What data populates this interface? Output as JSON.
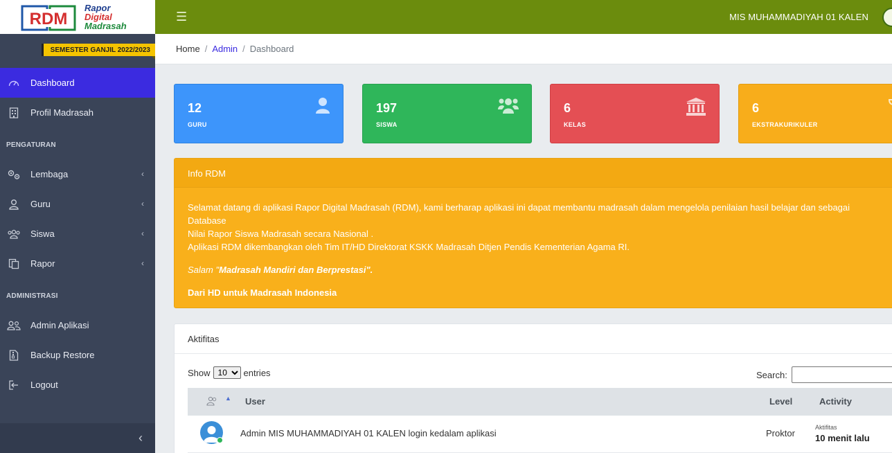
{
  "brand": {
    "line1": "Rapor",
    "line2": "Digital",
    "line3": "Madrasah",
    "logo_text": "RDM"
  },
  "semester": "SEMESTER GANJIL 2022/2023",
  "sidebar": {
    "items": [
      {
        "label": "Dashboard",
        "icon": "speedometer-icon",
        "active": true
      },
      {
        "label": "Profil Madrasah",
        "icon": "building-icon"
      }
    ],
    "section_pengaturan": "PENGATURAN",
    "pengaturan_items": [
      {
        "label": "Lembaga",
        "icon": "gears-icon"
      },
      {
        "label": "Guru",
        "icon": "user-icon"
      },
      {
        "label": "Siswa",
        "icon": "users-icon"
      },
      {
        "label": "Rapor",
        "icon": "copy-icon"
      }
    ],
    "section_admin": "ADMINISTRASI",
    "admin_items": [
      {
        "label": "Admin Aplikasi",
        "icon": "user-group-icon"
      },
      {
        "label": "Backup Restore",
        "icon": "file-archive-icon"
      },
      {
        "label": "Logout",
        "icon": "logout-icon"
      }
    ]
  },
  "header": {
    "school_name": "MIS MUHAMMADIYAH 01 KALEN"
  },
  "breadcrumb": {
    "home": "Home",
    "admin": "Admin",
    "current": "Dashboard",
    "sep": "/"
  },
  "stats": [
    {
      "value": "12",
      "label": "GURU",
      "color": "#3d95fb"
    },
    {
      "value": "197",
      "label": "SISWA",
      "color": "#2fb65a"
    },
    {
      "value": "6",
      "label": "KELAS",
      "color": "#e44f54"
    },
    {
      "value": "6",
      "label": "EKSTRAKURIKULER",
      "color": "#f8ad1b"
    }
  ],
  "info": {
    "title": "Info RDM",
    "line1": "Selamat datang di aplikasi Rapor Digital Madrasah (RDM), kami berharap aplikasi ini dapat membantu madrasah dalam mengelola penilaian hasil belajar dan sebagai Database",
    "line2": "Nilai Rapor Siswa Madrasah secara Nasional .",
    "line3": "Aplikasi RDM dikembangkan oleh Tim IT/HD Direktorat KSKK Madrasah Ditjen Pendis Kementerian Agama RI.",
    "salam_prefix": "Salam \"",
    "salam_bold": "Madrasah Mandiri dan Berprestasi",
    "salam_suffix": "\".",
    "closing": "Dari HD untuk Madrasah Indonesia"
  },
  "activity": {
    "title": "Aktifitas",
    "show_label": "Show",
    "entries_label": "entries",
    "page_size": "10",
    "search_label": "Search:",
    "columns": {
      "user": "User",
      "level": "Level",
      "activity": "Activity"
    },
    "rows": [
      {
        "user": "Admin MIS MUHAMMADIYAH 01 KALEN login kedalam aplikasi",
        "level": "Proktor",
        "activity_label": "Aktifitas",
        "activity_time": "10 menit lalu"
      }
    ]
  }
}
